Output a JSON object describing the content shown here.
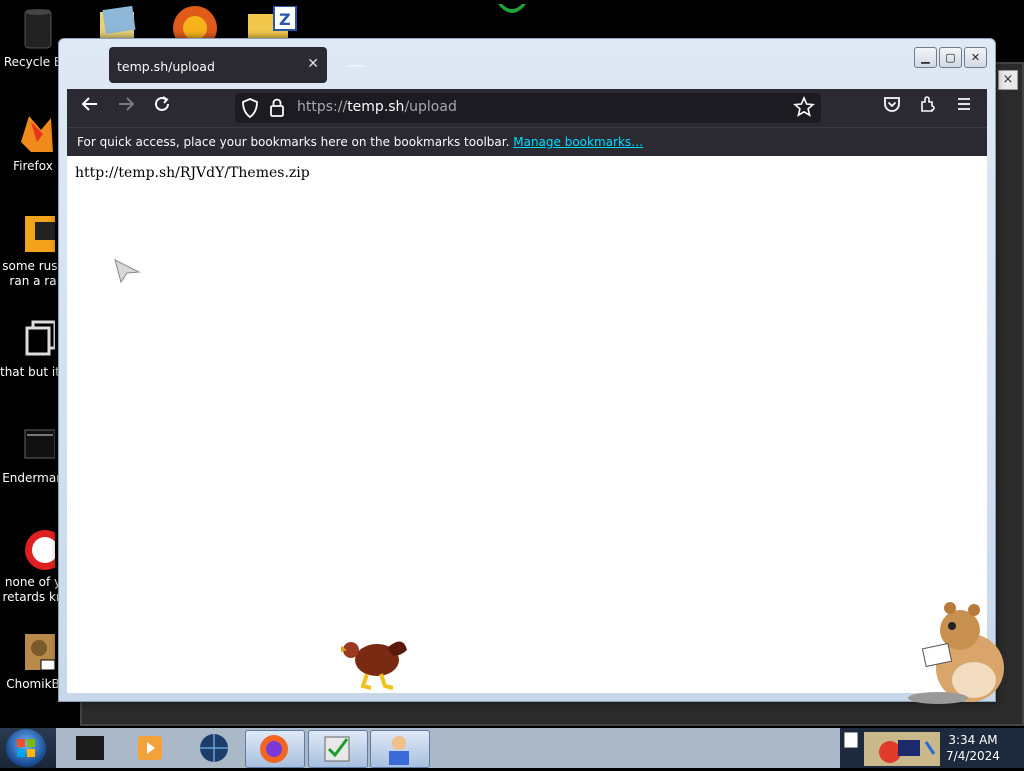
{
  "desktop": {
    "icons": [
      {
        "label": "Recycle B",
        "icon": "recycle-bin-icon"
      },
      {
        "label": "Firefox",
        "icon": "firefox-icon"
      },
      {
        "label": "some russ\nran a ra",
        "icon": "folder-icon"
      },
      {
        "label": "that but its",
        "icon": "document-icon"
      },
      {
        "label": "Enderman",
        "icon": "monitor-icon"
      },
      {
        "label": "none of y\nretards kn",
        "icon": "browser-icon"
      },
      {
        "label": "ChomikB",
        "icon": "hamster-icon"
      }
    ]
  },
  "browser": {
    "tab_title": "temp.sh/upload",
    "url_scheme": "https://",
    "url_host": "temp.sh",
    "url_path": "/upload",
    "bookmarks_text": "For quick access, place your bookmarks here on the bookmarks toolbar.",
    "bookmarks_link": "Manage bookmarks…",
    "page_text": "http://temp.sh/RJVdY/Themes.zip"
  },
  "taskbar": {
    "time": "3:34 AM",
    "date": "7/4/2024"
  }
}
